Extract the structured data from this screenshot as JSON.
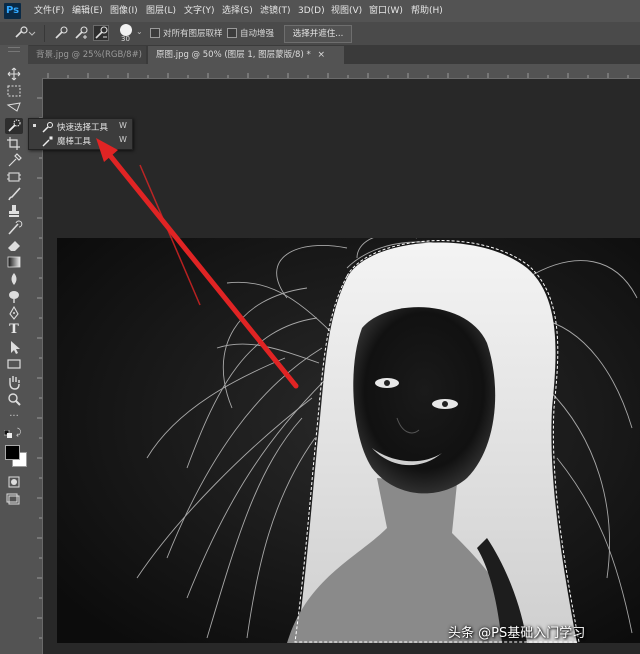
{
  "app": {
    "logo": "Ps"
  },
  "menu": [
    "文件(F)",
    "编辑(E)",
    "图像(I)",
    "图层(L)",
    "文字(Y)",
    "选择(S)",
    "滤镜(T)",
    "3D(D)",
    "视图(V)",
    "窗口(W)",
    "帮助(H)"
  ],
  "options": {
    "brush_size": "30",
    "sample_all_layers": "对所有图层取样",
    "auto_enhance": "自动增强",
    "select_and_mask": "选择并遮住..."
  },
  "tabs": [
    {
      "label": "背景.jpg @ 25%(RGB/8#)",
      "close": "×"
    },
    {
      "label": "原图.jpg @ 50% (图层 1, 图层蒙版/8) *",
      "close": "×"
    }
  ],
  "flyout": {
    "items": [
      {
        "label": "快速选择工具",
        "shortcut": "W",
        "icon": "quick-selection-icon"
      },
      {
        "label": "魔棒工具",
        "shortcut": "W",
        "icon": "magic-wand-icon"
      }
    ]
  },
  "watermark": "头条 @PS基础入门学习",
  "colors": {
    "arrow": "#e02424",
    "accent": "#31a8ff"
  }
}
